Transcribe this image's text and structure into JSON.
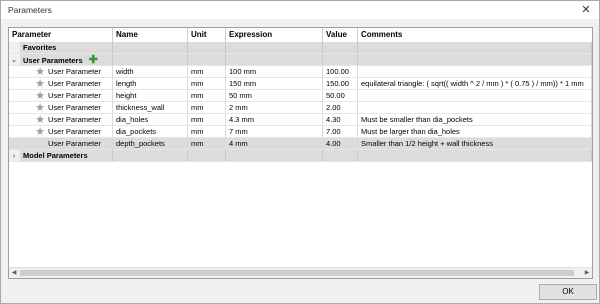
{
  "window": {
    "title": "Parameters",
    "close_glyph": "✕"
  },
  "columns": [
    "Parameter",
    "Name",
    "Unit",
    "Expression",
    "Value",
    "Comments"
  ],
  "groups": {
    "favorites": "Favorites",
    "user": "User Parameters",
    "model": "Model Parameters"
  },
  "rows": [
    {
      "parameter": "User Parameter",
      "name": "width",
      "unit": "mm",
      "expression": "100 mm",
      "value": "100.00",
      "comment": ""
    },
    {
      "parameter": "User Parameter",
      "name": "length",
      "unit": "mm",
      "expression": "150 mm",
      "value": "150.00",
      "comment": "equilateral triangle: ( sqrt(( width ^ 2 / mm ) * ( 0.75 ) / mm)) * 1 mm"
    },
    {
      "parameter": "User Parameter",
      "name": "height",
      "unit": "mm",
      "expression": "50 mm",
      "value": "50.00",
      "comment": ""
    },
    {
      "parameter": "User Parameter",
      "name": "thickness_wall",
      "unit": "mm",
      "expression": "2 mm",
      "value": "2.00",
      "comment": ""
    },
    {
      "parameter": "User Parameter",
      "name": "dia_holes",
      "unit": "mm",
      "expression": "4.3 mm",
      "value": "4.30",
      "comment": "Must be smaller than dia_pockets"
    },
    {
      "parameter": "User Parameter",
      "name": "dia_pockets",
      "unit": "mm",
      "expression": "7 mm",
      "value": "7.00",
      "comment": "Must be larger than dia_holes"
    },
    {
      "parameter": "User Parameter",
      "name": "depth_pockets",
      "unit": "mm",
      "expression": "4 mm",
      "value": "4.00",
      "comment": "Smaller than 1/2 height + wall thickness"
    }
  ],
  "ok_label": "OK",
  "icons": {
    "star": "star-icon",
    "add": "add-icon",
    "expand": "chevron-icon"
  }
}
